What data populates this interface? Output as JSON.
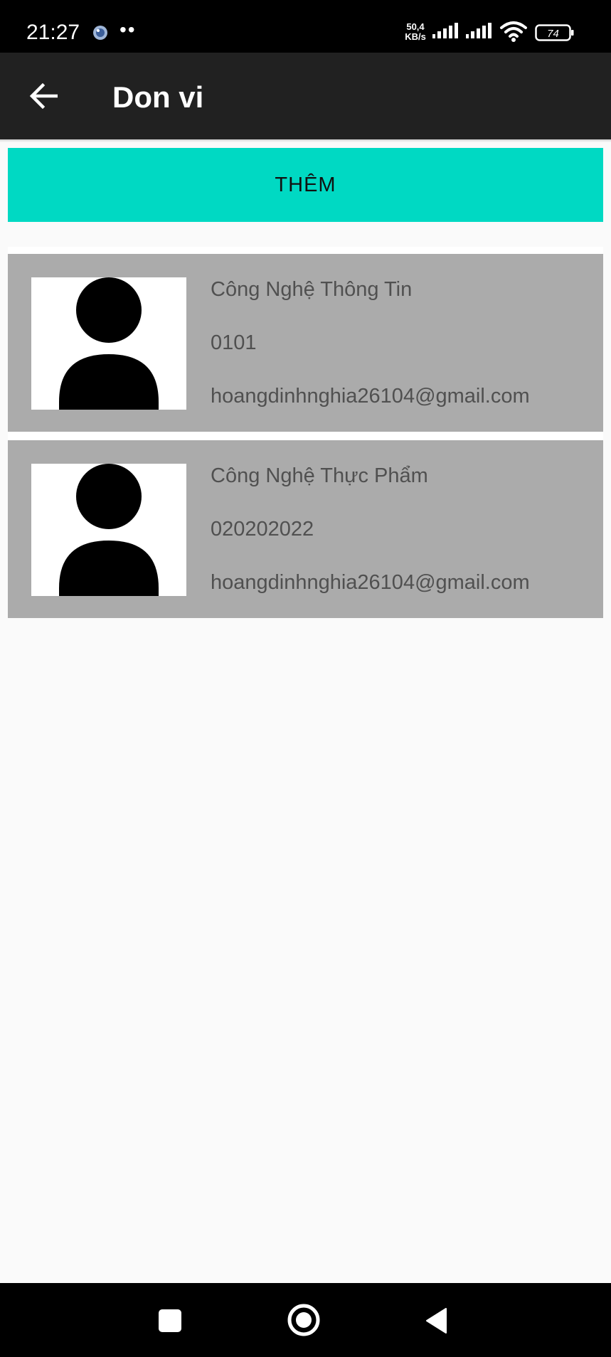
{
  "status_bar": {
    "time": "21:27",
    "dots": "••",
    "net_speed_value": "50,4",
    "net_speed_unit": "KB/s",
    "battery": "74"
  },
  "app_bar": {
    "title": "Don vi",
    "back_icon": "arrow-left-icon"
  },
  "add_button": {
    "label": "THÊM",
    "color": "#00d9c3"
  },
  "units": [
    {
      "name": "Công Nghệ Thông Tin",
      "code": "0101",
      "email": "hoangdinhnghia26104@gmail.com",
      "avatar_icon": "person-placeholder-icon"
    },
    {
      "name": "Công Nghệ Thực Phẩm",
      "code": "020202022",
      "email": "hoangdinhnghia26104@gmail.com",
      "avatar_icon": "person-placeholder-icon"
    }
  ],
  "nav_bar": {
    "recents_icon": "square-icon",
    "home_icon": "circle-icon",
    "back_icon": "triangle-back-icon"
  },
  "colors": {
    "app_bar": "#212121",
    "card": "#ababab",
    "background": "#fafafa"
  }
}
